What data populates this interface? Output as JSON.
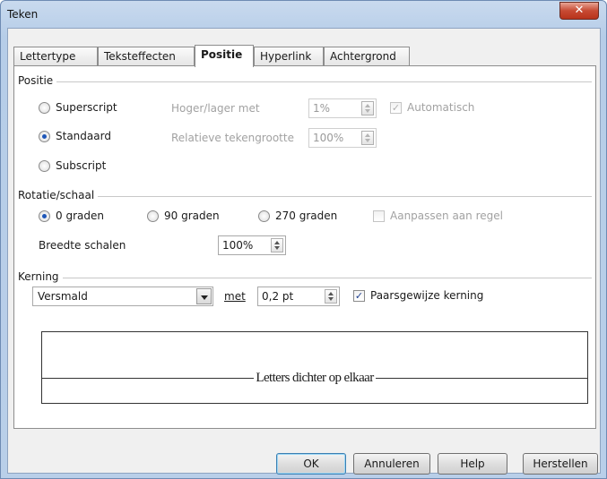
{
  "window": {
    "title": "Teken",
    "close_symbol": "✕"
  },
  "tabs": [
    "Lettertype",
    "Teksteffecten",
    "Positie",
    "Hyperlink",
    "Achtergrond"
  ],
  "positie": {
    "group": "Positie",
    "superscript": "Superscript",
    "standaard": "Standaard",
    "subscript": "Subscript",
    "hoger_lager_label": "Hoger/lager met",
    "hoger_lager_value": "1%",
    "automatisch_label": "Automatisch",
    "relatieve_label": "Relatieve tekengrootte",
    "relatieve_value": "100%"
  },
  "rotatie": {
    "group": "Rotatie/schaal",
    "r0": "0 graden",
    "r90": "90 graden",
    "r270": "270 graden",
    "aanpassen": "Aanpassen aan regel",
    "breedte_label": "Breedte schalen",
    "breedte_value": "100%"
  },
  "kerning": {
    "group": "Kerning",
    "select_value": "Versmald",
    "met_label": "met",
    "met_value": "0,2 pt",
    "paarsgewijze": "Paarsgewijze kerning"
  },
  "preview": {
    "text": "Letters dichter op elkaar"
  },
  "buttons": {
    "ok": "OK",
    "cancel": "Annuleren",
    "help": "Help",
    "reset": "Herstellen"
  }
}
